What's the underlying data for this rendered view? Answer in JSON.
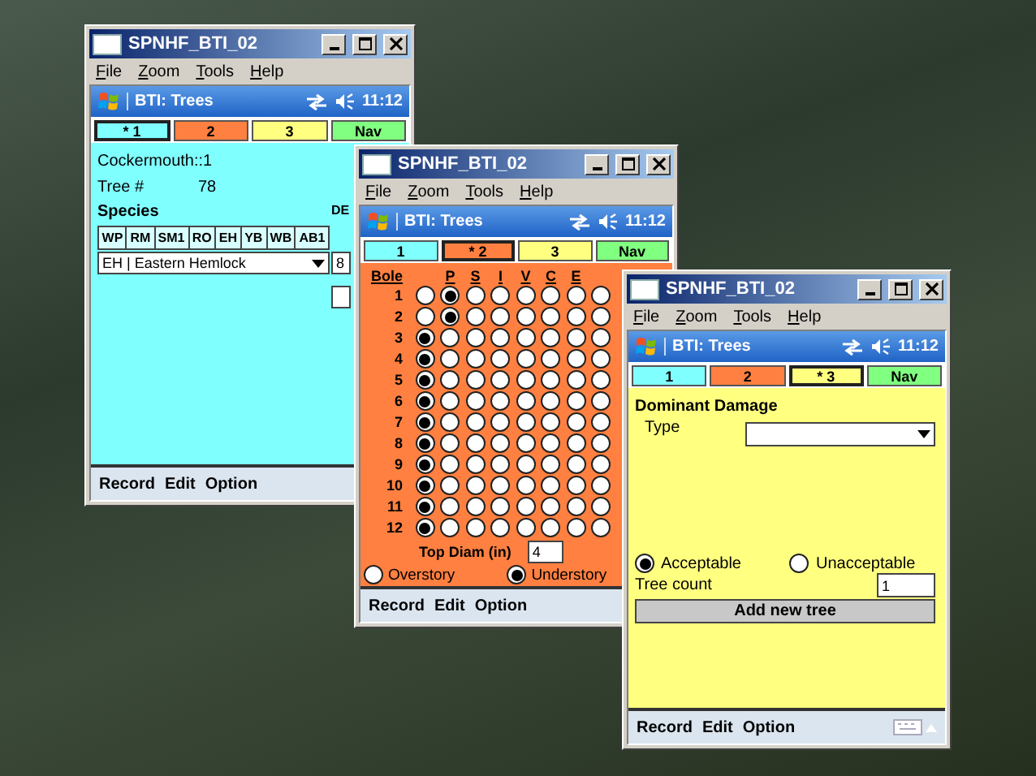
{
  "windows": [
    {
      "title": "SPNHF_BTI_02",
      "menu": [
        "File",
        "Zoom",
        "Tools",
        "Help"
      ],
      "header": {
        "title": "BTI: Trees",
        "time": "11:12"
      },
      "tabs": [
        {
          "label": "* 1",
          "color": "#80ffff",
          "selected": true
        },
        {
          "label": "2",
          "color": "#ff8040",
          "selected": false
        },
        {
          "label": "3",
          "color": "#ffff80",
          "selected": false
        },
        {
          "label": "Nav",
          "color": "#80ff80",
          "selected": false
        }
      ],
      "screen": {
        "kind": "tree",
        "location": "Cockermouth::1",
        "tree_label": "Tree #",
        "tree_number": "78",
        "species_label": "Species",
        "species_buttons": [
          "WP",
          "RM",
          "SM1",
          "RO",
          "EH",
          "YB",
          "WB",
          "AB1"
        ],
        "species_value": "EH | Eastern Hemlock",
        "side_label": "DE",
        "side_value": "8"
      },
      "soft_menu": [
        "Record",
        "Edit",
        "Option"
      ]
    },
    {
      "title": "SPNHF_BTI_02",
      "menu": [
        "File",
        "Zoom",
        "Tools",
        "Help"
      ],
      "header": {
        "title": "BTI: Trees",
        "time": "11:12"
      },
      "tabs": [
        {
          "label": "1",
          "color": "#80ffff",
          "selected": false
        },
        {
          "label": "* 2",
          "color": "#ff8040",
          "selected": true
        },
        {
          "label": "3",
          "color": "#ffff80",
          "selected": false
        },
        {
          "label": "Nav",
          "color": "#80ff80",
          "selected": false
        }
      ],
      "screen": {
        "kind": "bole",
        "row_header": "Bole",
        "columns": [
          "P",
          "S",
          "I",
          "V",
          "C",
          "E"
        ],
        "rows": [
          {
            "label": "1",
            "selected": [
              false,
              true,
              false,
              false,
              false,
              false,
              false,
              false
            ]
          },
          {
            "label": "2",
            "selected": [
              false,
              true,
              false,
              false,
              false,
              false,
              false,
              false
            ]
          },
          {
            "label": "3",
            "selected": [
              true,
              false,
              false,
              false,
              false,
              false,
              false,
              false
            ]
          },
          {
            "label": "4",
            "selected": [
              true,
              false,
              false,
              false,
              false,
              false,
              false,
              false
            ]
          },
          {
            "label": "5",
            "selected": [
              true,
              false,
              false,
              false,
              false,
              false,
              false,
              false
            ]
          },
          {
            "label": "6",
            "selected": [
              true,
              false,
              false,
              false,
              false,
              false,
              false,
              false
            ]
          },
          {
            "label": "7",
            "selected": [
              true,
              false,
              false,
              false,
              false,
              false,
              false,
              false
            ]
          },
          {
            "label": "8",
            "selected": [
              true,
              false,
              false,
              false,
              false,
              false,
              false,
              false
            ]
          },
          {
            "label": "9",
            "selected": [
              true,
              false,
              false,
              false,
              false,
              false,
              false,
              false
            ]
          },
          {
            "label": "10",
            "selected": [
              true,
              false,
              false,
              false,
              false,
              false,
              false,
              false
            ]
          },
          {
            "label": "11",
            "selected": [
              true,
              false,
              false,
              false,
              false,
              false,
              false,
              false
            ]
          },
          {
            "label": "12",
            "selected": [
              true,
              false,
              false,
              false,
              false,
              false,
              false,
              false
            ]
          }
        ],
        "top_diam_label": "Top Diam (in)",
        "top_diam": "4",
        "story": [
          {
            "label": "Overstory",
            "selected": false
          },
          {
            "label": "Understory",
            "selected": true
          }
        ]
      },
      "soft_menu": [
        "Record",
        "Edit",
        "Option"
      ]
    },
    {
      "title": "SPNHF_BTI_02",
      "menu": [
        "File",
        "Zoom",
        "Tools",
        "Help"
      ],
      "header": {
        "title": "BTI: Trees",
        "time": "11:12"
      },
      "tabs": [
        {
          "label": "1",
          "color": "#80ffff",
          "selected": false
        },
        {
          "label": "2",
          "color": "#ff8040",
          "selected": false
        },
        {
          "label": "* 3",
          "color": "#ffff80",
          "selected": true
        },
        {
          "label": "Nav",
          "color": "#80ff80",
          "selected": false
        }
      ],
      "screen": {
        "kind": "damage",
        "heading": "Dominant Damage",
        "type_label": "Type",
        "rating": [
          {
            "label": "Acceptable",
            "selected": true
          },
          {
            "label": "Unacceptable",
            "selected": false
          }
        ],
        "count_label": "Tree count",
        "count": "1",
        "button": "Add new tree"
      },
      "soft_menu": [
        "Record",
        "Edit",
        "Option"
      ],
      "input_panel": true
    }
  ]
}
